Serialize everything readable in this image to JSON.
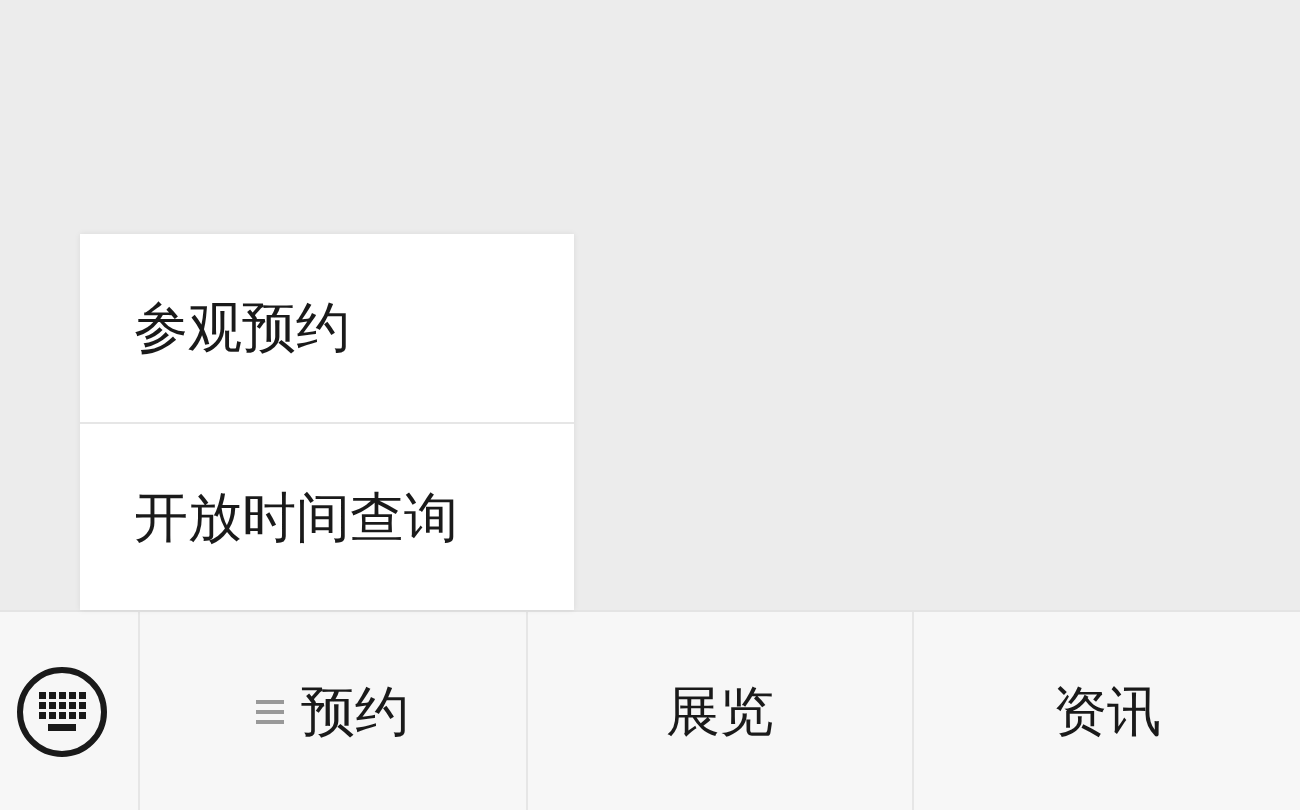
{
  "popup_menu": {
    "items": [
      {
        "label": "参观预约"
      },
      {
        "label": "开放时间查询"
      }
    ]
  },
  "bottom_menu": {
    "tabs": [
      {
        "label": "预约",
        "has_submenu": true
      },
      {
        "label": "展览",
        "has_submenu": false
      },
      {
        "label": "资讯",
        "has_submenu": false
      }
    ]
  }
}
